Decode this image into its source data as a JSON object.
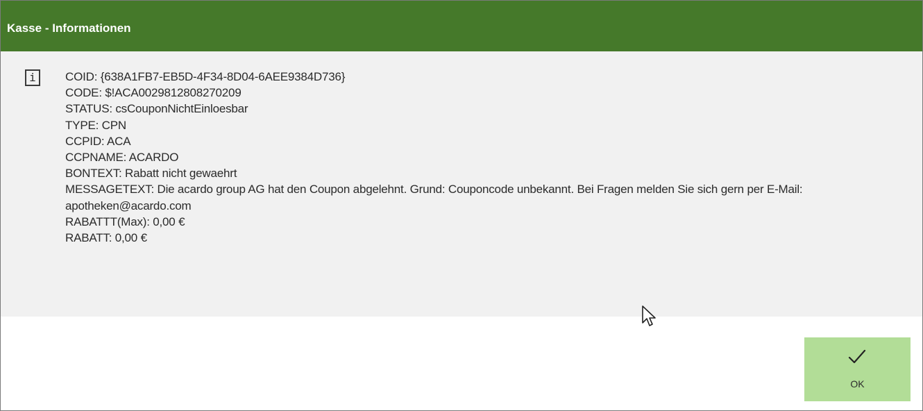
{
  "window": {
    "title": "Kasse - Informationen"
  },
  "message": {
    "icon": "info-icon",
    "icon_glyph": "i",
    "lines": {
      "coid": "COID: {638A1FB7-EB5D-4F34-8D04-6AEE9384D736}",
      "code": "CODE: $!ACA0029812808270209",
      "status": "STATUS: csCouponNichtEinloesbar",
      "type": "TYPE: CPN",
      "ccpid": "CCPID: ACA",
      "ccpname": "CCPNAME: ACARDO",
      "bontext": "BONTEXT: Rabatt nicht gewaehrt",
      "messagetext": "MESSAGETEXT: Die acardo group AG hat den Coupon abgelehnt. Grund: Couponcode unbekannt. Bei Fragen melden Sie sich gern per E-Mail: apotheken@acardo.com",
      "rabatt_max": "RABATTT(Max): 0,00 €",
      "rabatt": "RABATT: 0,00 €"
    }
  },
  "buttons": {
    "ok_label": "OK",
    "ok_icon": "checkmark-icon"
  },
  "colors": {
    "titlebar": "#45792a",
    "content_background": "#f1f1f1",
    "ok_button": "#b2dd97"
  }
}
